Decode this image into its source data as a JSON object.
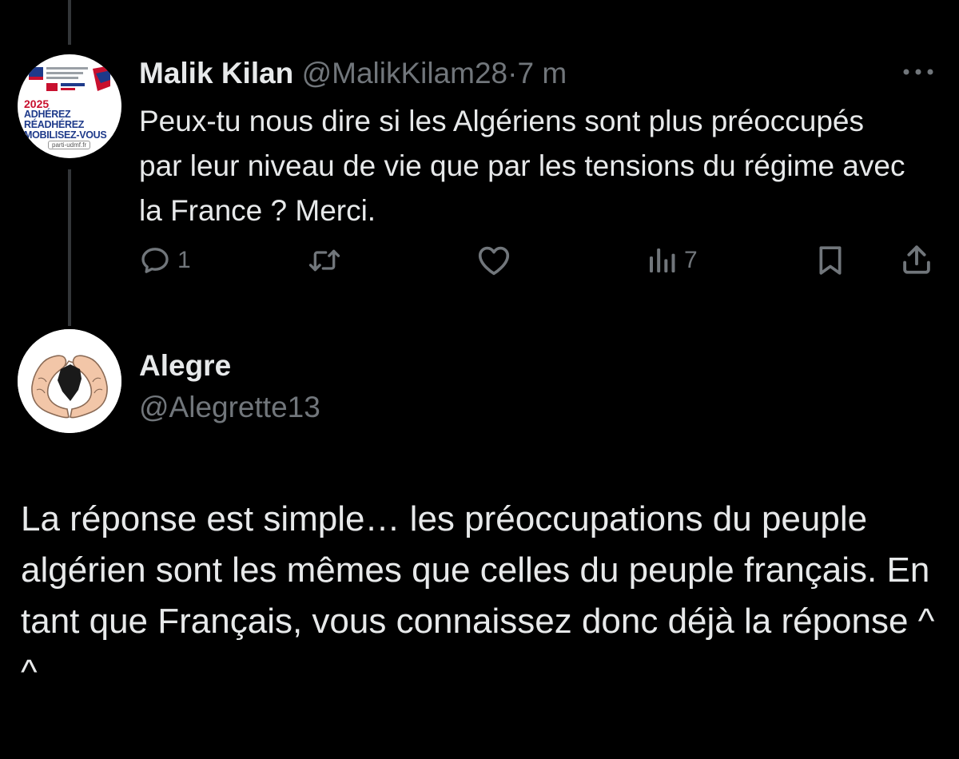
{
  "parent_tweet": {
    "author_name": "Malik Kilan",
    "handle": "@MalikKilam28",
    "separator": "·",
    "time": "7 m",
    "avatar": {
      "year": "2025",
      "line1": "ADHÉREZ",
      "line2": "RÉADHÉREZ",
      "line3": "MOBILISEZ-VOUS",
      "url": "parti-udmf.fr"
    },
    "text": "Peux-tu nous dire si les Algériens sont plus préoccupés par leur niveau de vie que par les tensions du régime avec la France ? Merci.",
    "actions": {
      "reply_count": "1",
      "retweet_count": "",
      "like_count": "",
      "views_count": "7"
    }
  },
  "reply_tweet": {
    "author_name": "Alegre",
    "handle": "@Alegrette13",
    "text": "La réponse est simple… les préoccupations du peuple algérien sont les mêmes que celles du peuple français. En tant que Français, vous connaissez donc déjà la réponse ^ ^"
  },
  "colors": {
    "background": "#000000",
    "primary_text": "#e7e9ea",
    "secondary_text": "#71767b",
    "thread_line": "#333639"
  }
}
